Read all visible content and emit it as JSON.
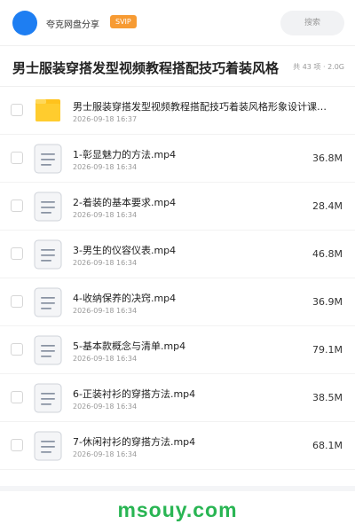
{
  "header": {
    "user_name": "夸克网盘分享",
    "vip_badge": "SVIP",
    "search_placeholder": "搜索"
  },
  "folder": {
    "title": "男士服装穿搭发型视频教程搭配技巧着装风格",
    "meta": "共 43 项 · 2.0G"
  },
  "files": [
    {
      "type": "folder-icon",
      "name": "男士服装穿搭发型视频教程搭配技巧着装风格形象设计课…",
      "date": "2026-09-18 16:37",
      "size": ""
    },
    {
      "type": "document-icon",
      "name": "1-彰显魅力的方法.mp4",
      "date": "2026-09-18 16:34",
      "size": "36.8M"
    },
    {
      "type": "document-icon",
      "name": "2-着装的基本要求.mp4",
      "date": "2026-09-18 16:34",
      "size": "28.4M"
    },
    {
      "type": "document-icon",
      "name": "3-男生的仪容仪表.mp4",
      "date": "2026-09-18 16:34",
      "size": "46.8M"
    },
    {
      "type": "document-icon",
      "name": "4-收纳保养的决窍.mp4",
      "date": "2026-09-18 16:34",
      "size": "36.9M"
    },
    {
      "type": "document-icon",
      "name": "5-基本款概念与清单.mp4",
      "date": "2026-09-18 16:34",
      "size": "79.1M"
    },
    {
      "type": "document-icon",
      "name": "6-正装衬衫的穿搭方法.mp4",
      "date": "2026-09-18 16:34",
      "size": "38.5M"
    },
    {
      "type": "document-icon",
      "name": "7-休闲衬衫的穿搭方法.mp4",
      "date": "2026-09-18 16:34",
      "size": "68.1M"
    }
  ],
  "watermark": "msouy.com"
}
